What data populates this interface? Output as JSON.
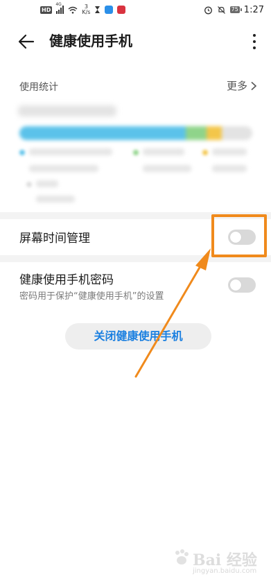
{
  "status_bar": {
    "left_badge": "HD",
    "network": "4G",
    "speed_value": "3",
    "speed_unit": "K/s",
    "battery": "75",
    "time": "1:27",
    "icons": [
      "hd-icon",
      "signal-icon",
      "wifi-icon",
      "hourglass-icon",
      "app-notification-icon",
      "app-notification-icon",
      "alarm-icon",
      "mute-icon",
      "battery-icon"
    ]
  },
  "header": {
    "title": "健康使用手机",
    "back_icon": "arrow-left-icon",
    "menu_icon": "more-vertical-icon"
  },
  "usage": {
    "section_title": "使用统计",
    "more_label": "更多",
    "more_icon": "chevron-right-icon",
    "bar_colors": [
      "#5bc2ea",
      "#8fd48a",
      "#f3c64a",
      "#e3e3e3"
    ],
    "blurred": true
  },
  "settings": {
    "screen_time": {
      "label": "屏幕时间管理",
      "enabled": false
    },
    "password": {
      "label": "健康使用手机密码",
      "description": "密码用于保护“健康使用手机”的设置",
      "enabled": false
    }
  },
  "actions": {
    "close_label": "关闭健康使用手机"
  },
  "annotation": {
    "color": "#f08a1c"
  },
  "watermark": {
    "brand": "Bai 经验",
    "url": "jingyan.baidu.com"
  },
  "colors": {
    "accent": "#1a7fe0",
    "toggle_off": "#d9d9d9",
    "highlight": "#f08a1c"
  }
}
